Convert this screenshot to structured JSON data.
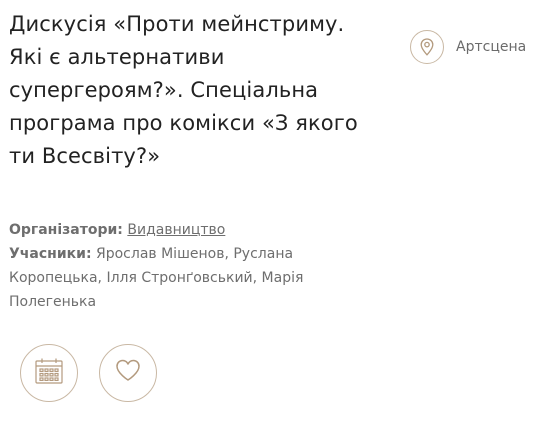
{
  "event": {
    "title_lines": [
      "Дискусія «Проти мейнстриму.",
      "Які є альтернативи",
      "супергероям?». Спеціальна",
      "програма про комікси «З якого",
      "ти Всесвіту?»"
    ]
  },
  "venue": {
    "icon": "map-pin-icon",
    "label": "Артсцена"
  },
  "meta": {
    "organizers_label": "Організатори:",
    "organizers_value": "Видавництво",
    "participants_label": "Учасники:",
    "participants_value": "Ярослав Мішенов, Руслана Коропецька, Ілля Стронґовський, Марія Полегенька"
  },
  "actions": {
    "calendar_icon": "calendar-icon",
    "favorite_icon": "heart-icon"
  },
  "colors": {
    "accent": "#c9b8a4",
    "icon_stroke": "#b39a7e",
    "title_text": "#222222",
    "meta_text": "#6e6e6e"
  }
}
